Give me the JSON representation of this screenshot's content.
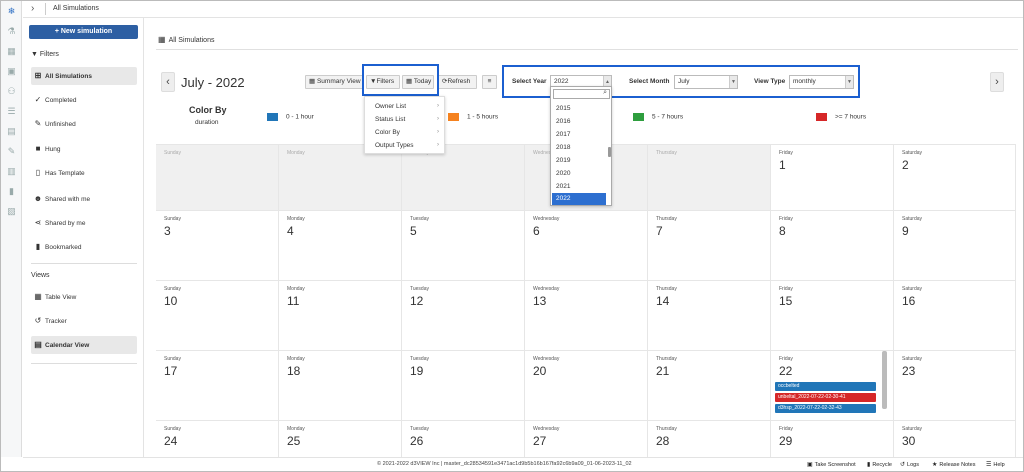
{
  "breadcrumb": {
    "current": "All Simulations"
  },
  "sidebar": {
    "new_button": "+ New simulation",
    "filters_title": "Filters",
    "filters": [
      {
        "label": "All Simulations",
        "icon": "grid-icon",
        "active": true
      },
      {
        "label": "Completed",
        "icon": "check-icon",
        "active": false
      },
      {
        "label": "Unfinished",
        "icon": "edit-icon",
        "active": false
      },
      {
        "label": "Hung",
        "icon": "square-icon",
        "active": false
      },
      {
        "label": "Has Template",
        "icon": "file-icon",
        "active": false
      },
      {
        "label": "Shared with me",
        "icon": "users-icon",
        "active": false
      },
      {
        "label": "Shared by me",
        "icon": "share-icon",
        "active": false
      },
      {
        "label": "Bookmarked",
        "icon": "bookmark-icon",
        "active": false
      }
    ],
    "views_title": "Views",
    "views": [
      {
        "label": "Table View",
        "icon": "table-icon",
        "active": false
      },
      {
        "label": "Tracker",
        "icon": "history-icon",
        "active": false
      },
      {
        "label": "Calendar View",
        "icon": "calendar-icon",
        "active": true
      }
    ]
  },
  "main": {
    "title": "All Simulations",
    "month_title": "July - 2022",
    "toolbar": {
      "summary": "Summary View",
      "filters": "Filters",
      "today": "Today",
      "refresh": "Refresh",
      "menu": "≡"
    },
    "selects": {
      "year_label": "Select Year",
      "year_value": "2022",
      "month_label": "Select Month",
      "month_value": "July",
      "view_label": "View Type",
      "view_value": "monthly"
    },
    "color_by": {
      "title": "Color By",
      "subtitle": "duration",
      "legend": [
        {
          "label": "0 - 1 hour",
          "color": "#2176b8"
        },
        {
          "label": "1 - 5 hours",
          "color": "#f5821f"
        },
        {
          "label": "5 - 7 hours",
          "color": "#2e9e3e"
        },
        {
          "label": ">= 7 hours",
          "color": "#d62728"
        }
      ]
    },
    "filter_menu": [
      "Owner List",
      "Status List",
      "Color By",
      "Output Types"
    ],
    "year_options": [
      "2015",
      "2016",
      "2017",
      "2018",
      "2019",
      "2020",
      "2021",
      "2022"
    ],
    "day_names": [
      "Sunday",
      "Monday",
      "Tuesday",
      "Wednesday",
      "Thursday",
      "Friday",
      "Saturday"
    ],
    "weeks": [
      [
        "",
        "",
        "",
        "",
        "",
        "1",
        "2"
      ],
      [
        "3",
        "4",
        "5",
        "6",
        "7",
        "8",
        "9"
      ],
      [
        "10",
        "11",
        "12",
        "13",
        "14",
        "15",
        "16"
      ],
      [
        "17",
        "18",
        "19",
        "20",
        "21",
        "22",
        "23"
      ],
      [
        "24",
        "25",
        "26",
        "27",
        "28",
        "29",
        "30"
      ]
    ],
    "events": [
      {
        "label": "occbelted",
        "color": "#2176b8"
      },
      {
        "label": "unbeltal_2022-07-22-02-30-41",
        "color": "#d62728"
      },
      {
        "label": "d3hsp_2022-07-22-02-32-43",
        "color": "#2176b8"
      }
    ]
  },
  "footer": {
    "copyright": "© 2021-2022 d3VIEW Inc | master_dc28534591e3471ac1d9b5b16b167fa92c6b9a09_01-06-2023-11_02",
    "actions": [
      {
        "label": "Take Screenshot",
        "icon": "camera-icon"
      },
      {
        "label": "Recycle",
        "icon": "trash-icon"
      },
      {
        "label": "Logs",
        "icon": "history-icon"
      },
      {
        "label": "Release Notes",
        "icon": "star-icon"
      },
      {
        "label": "Help",
        "icon": "help-icon"
      }
    ]
  }
}
